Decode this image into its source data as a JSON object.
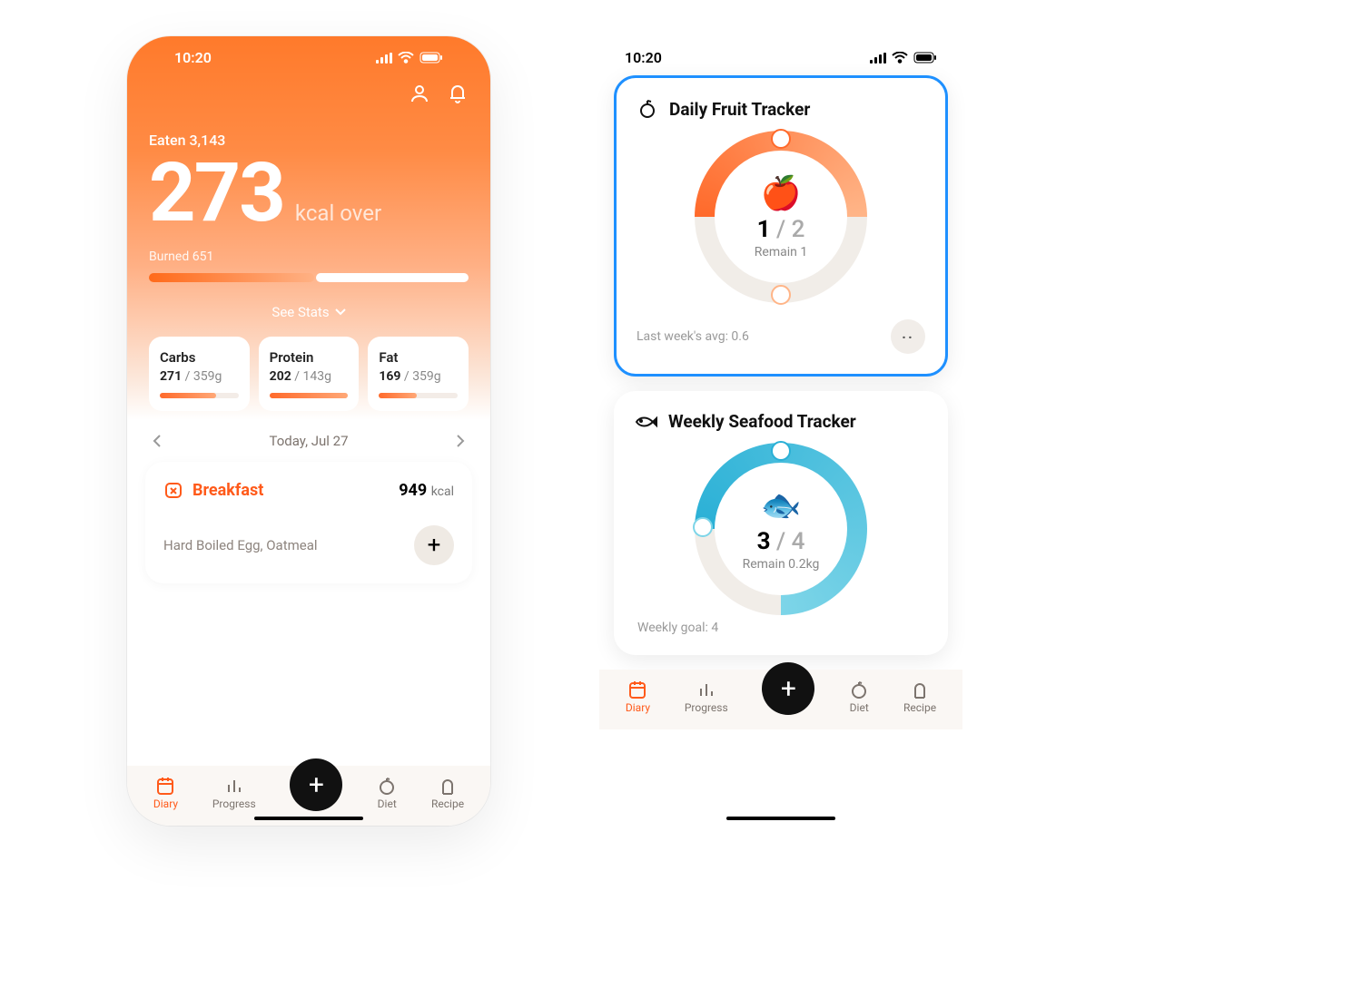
{
  "status": {
    "time": "10:20"
  },
  "hero": {
    "eaten_label": "Eaten 3,143",
    "big_value": "273",
    "big_unit": "kcal over",
    "burned_label": "Burned  651",
    "see_stats": "See Stats"
  },
  "macros": [
    {
      "name": "Carbs",
      "current": "271",
      "total": "359g",
      "fill": "72%"
    },
    {
      "name": "Protein",
      "current": "202",
      "total": "143g",
      "fill": "100%"
    },
    {
      "name": "Fat",
      "current": "169",
      "total": "359g",
      "fill": "48%"
    }
  ],
  "date": "Today, Jul 27",
  "meal": {
    "name": "Breakfast",
    "kcal": "949",
    "kcal_unit": "kcal",
    "items": "Hard Boiled Egg, Oatmeal"
  },
  "tabs": [
    "Diary",
    "Progress",
    "Diet",
    "Recipe"
  ],
  "trackers": {
    "fruit": {
      "title": "Daily Fruit Tracker",
      "count": "1",
      "total": "2",
      "remain": "Remain 1",
      "avg": "Last week's avg: 0.6"
    },
    "seafood": {
      "title": "Weekly Seafood Tracker",
      "count": "3",
      "total": "4",
      "remain": "Remain 0.2kg",
      "peek": "Weekly goal: 4"
    }
  }
}
